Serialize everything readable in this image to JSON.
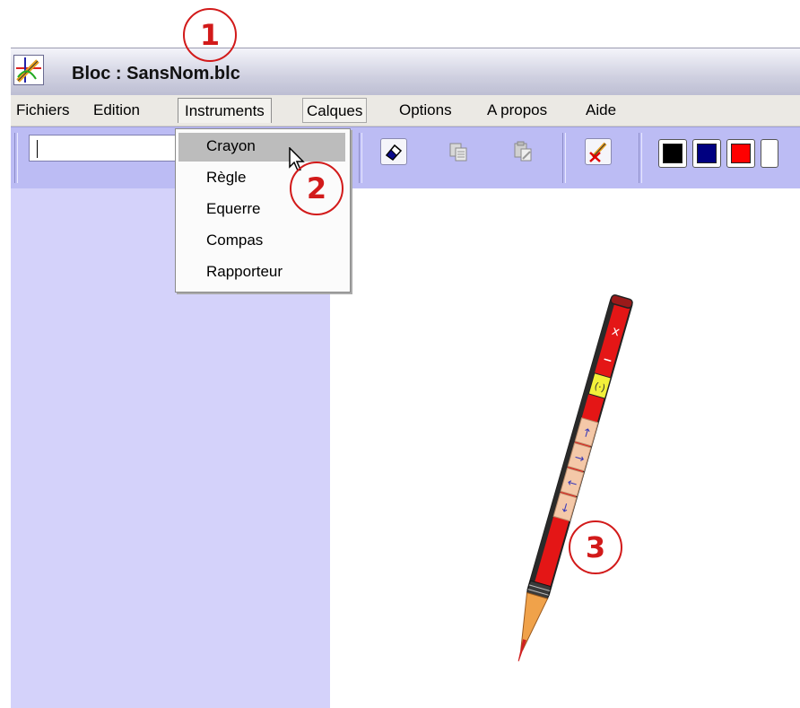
{
  "window": {
    "title": "Bloc : SansNom.blc"
  },
  "menubar": {
    "items": [
      {
        "label": "Fichiers"
      },
      {
        "label": "Edition"
      },
      {
        "label": "Instruments"
      },
      {
        "label": "Calques"
      },
      {
        "label": "Options"
      },
      {
        "label": "A propos"
      },
      {
        "label": "Aide"
      }
    ]
  },
  "instruments_menu": {
    "items": [
      {
        "label": "Crayon"
      },
      {
        "label": "Règle"
      },
      {
        "label": "Equerre"
      },
      {
        "label": "Compas"
      },
      {
        "label": "Rapporteur"
      }
    ],
    "highlighted": "Crayon"
  },
  "toolbar": {
    "text_input_value": "",
    "buttons": [
      "eraser-icon",
      "copy-layer-icon",
      "paste-layer-icon",
      "clear-drawing-icon"
    ],
    "colors": [
      "#000000",
      "#000080",
      "#ff0000"
    ]
  },
  "annotations": {
    "one": "1",
    "two": "2",
    "three": "3",
    "color": "#d21a1a"
  },
  "icons": {
    "app": "app-icon",
    "cursor": "mouse-pointer-icon",
    "pencil": "pencil-tool-icon"
  }
}
